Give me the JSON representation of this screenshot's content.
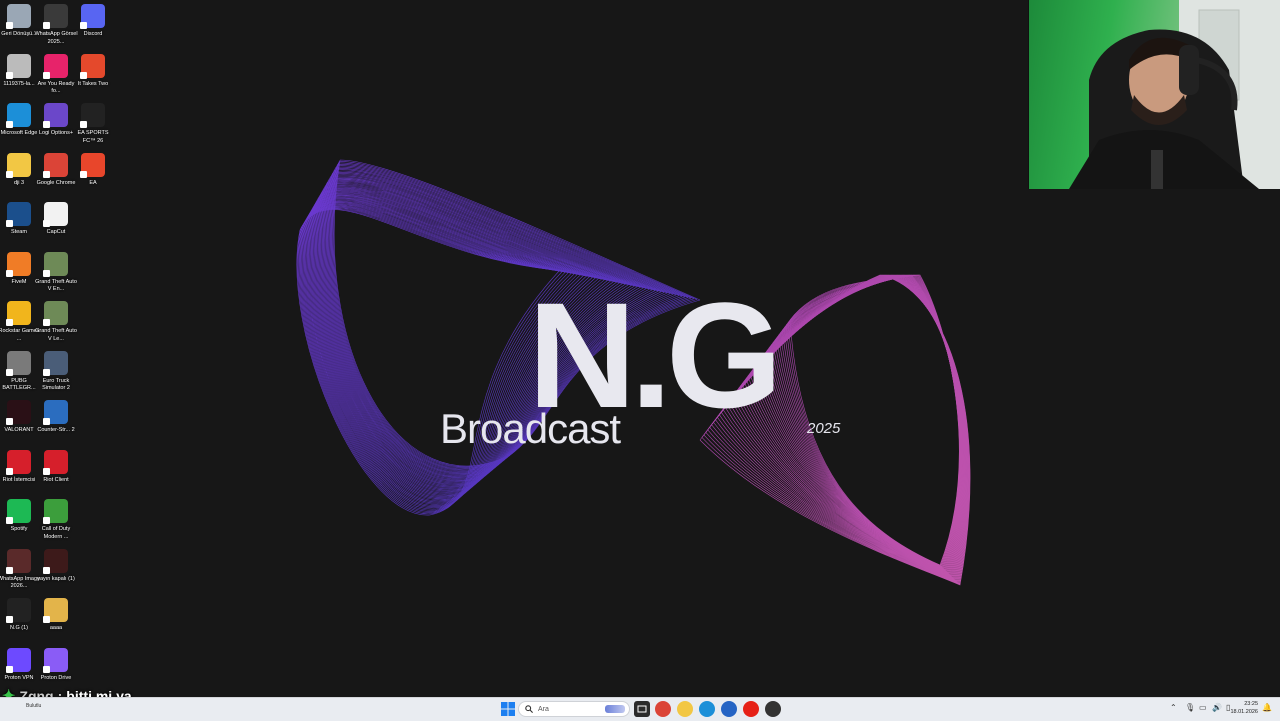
{
  "wallpaper": {
    "logo_main": "N.G",
    "logo_sub": "Broadcast",
    "year": "2025"
  },
  "desktop_icons": [
    {
      "label": "Geri Dönüşü...",
      "icon": "recycle-bin-icon",
      "color": "#9aa7b5"
    },
    {
      "label": "WhatsApp Görsel 2025...",
      "icon": "image-thumbnail-icon",
      "color": "#3a3a3a"
    },
    {
      "label": "Discord",
      "icon": "discord-icon",
      "color": "#5865f2"
    },
    {
      "label": "1119375-la...",
      "icon": "file-thumbnail-icon",
      "color": "#bbbbbb"
    },
    {
      "label": "Are You Ready fo...",
      "icon": "are-you-ready-icon",
      "color": "#e7236a"
    },
    {
      "label": "It Takes Two",
      "icon": "it-takes-two-icon",
      "color": "#e4492c"
    },
    {
      "label": "Microsoft Edge",
      "icon": "edge-icon",
      "color": "#1c8fd8"
    },
    {
      "label": "Logi Options+",
      "icon": "logi-options-icon",
      "color": "#6b47c9"
    },
    {
      "label": "EA SPORTS FC™ 26",
      "icon": "ea-sports-fc-icon",
      "color": "#222222"
    },
    {
      "label": "dji 3",
      "icon": "folder-icon",
      "color": "#f2c744"
    },
    {
      "label": "Google Chrome",
      "icon": "chrome-icon",
      "color": "#db4437"
    },
    {
      "label": "EA",
      "icon": "ea-icon",
      "color": "#e8462b"
    },
    {
      "label": "Steam",
      "icon": "steam-icon",
      "color": "#1b4f8c"
    },
    {
      "label": "CapCut",
      "icon": "capcut-icon",
      "color": "#f2f2f2"
    },
    {
      "label": "FiveM",
      "icon": "fivem-icon",
      "color": "#f07c26"
    },
    {
      "label": "Grand Theft Auto V En...",
      "icon": "gta-v-icon",
      "color": "#6e8a57"
    },
    {
      "label": "Rockstar Games ...",
      "icon": "rockstar-icon",
      "color": "#f1b51c"
    },
    {
      "label": "Grand Theft Auto V Le...",
      "icon": "gta-v-icon",
      "color": "#6e8a57"
    },
    {
      "label": "PUBG BATTLEGR...",
      "icon": "pubg-icon",
      "color": "#7a7a7a"
    },
    {
      "label": "Euro Truck Simulator 2",
      "icon": "euro-truck-icon",
      "color": "#4a5d78"
    },
    {
      "label": "VALORANT",
      "icon": "valorant-icon",
      "color": "#2a1016"
    },
    {
      "label": "Counter-Str... 2",
      "icon": "counter-strike-icon",
      "color": "#2b6dbf"
    },
    {
      "label": "Riot İstemcisi",
      "icon": "riot-client-icon",
      "color": "#d61f2b"
    },
    {
      "label": "Riot Client",
      "icon": "riot-client-icon",
      "color": "#d61f2b"
    },
    {
      "label": "Spotify",
      "icon": "spotify-icon",
      "color": "#1db954"
    },
    {
      "label": "Call of Duty Modern ...",
      "icon": "call-of-duty-icon",
      "color": "#3c9e3c"
    },
    {
      "label": "WhatsApp Image 2026...",
      "icon": "image-thumbnail-icon",
      "color": "#5a2a2a"
    },
    {
      "label": "yayın kapalı (1)",
      "icon": "image-thumbnail-icon",
      "color": "#3d1a1a"
    },
    {
      "label": "N.G (1)",
      "icon": "image-thumbnail-icon",
      "color": "#222222"
    },
    {
      "label": "aaaa",
      "icon": "folder-icon",
      "color": "#e3b44a"
    },
    {
      "label": "Proton VPN",
      "icon": "proton-vpn-icon",
      "color": "#6d4aff"
    },
    {
      "label": "Proton Drive",
      "icon": "proton-drive-icon",
      "color": "#8a5cf6"
    }
  ],
  "chat": {
    "username": "Zgng",
    "separator": ":",
    "message": "bitti mi ya"
  },
  "taskbar": {
    "search_placeholder": "Ara",
    "weather_text": "Bulutlu",
    "clock_time": "23:25",
    "clock_date": "18.01.2026",
    "pinned": [
      {
        "name": "chrome-taskbar-icon",
        "color": "#db4437"
      },
      {
        "name": "file-explorer-taskbar-icon",
        "color": "#f2c744"
      },
      {
        "name": "edge-taskbar-icon",
        "color": "#1c8fd8"
      },
      {
        "name": "store-taskbar-icon",
        "color": "#2564c4"
      },
      {
        "name": "youtube-taskbar-icon",
        "color": "#e62117"
      },
      {
        "name": "obs-taskbar-icon",
        "color": "#333333"
      }
    ]
  }
}
